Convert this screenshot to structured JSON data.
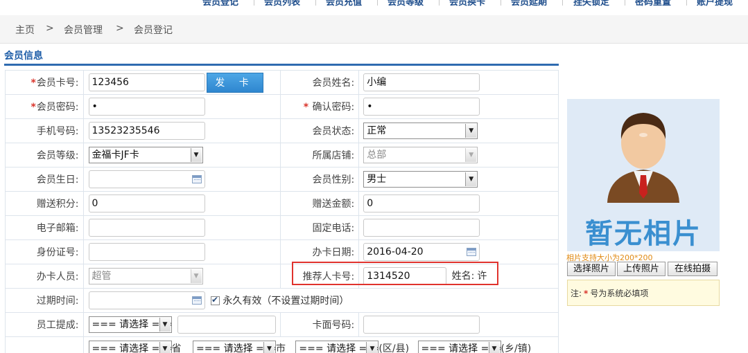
{
  "topnav": {
    "items": [
      "会员登记",
      "会员列表",
      "会员充值",
      "会员等级",
      "会员换卡",
      "会员延期",
      "挂失锁定",
      "密码重置",
      "账户提现"
    ]
  },
  "breadcrumb": [
    "主页",
    "会员管理",
    "会员登记"
  ],
  "breadcrumb_sep": ">",
  "section_title": "会员信息",
  "required_mark": "*",
  "form": {
    "card_no": {
      "label": "会员卡号:",
      "value": "123456"
    },
    "issue_button": "发 卡",
    "member_name": {
      "label": "会员姓名:",
      "value": "小编"
    },
    "password": {
      "label": "会员密码:",
      "value": "•"
    },
    "confirm_password": {
      "label": "确认密码:",
      "value": "•"
    },
    "phone": {
      "label": "手机号码:",
      "value": "13523235546"
    },
    "status": {
      "label": "会员状态:",
      "value": "正常"
    },
    "level": {
      "label": "会员等级:",
      "value": "金福卡JF卡"
    },
    "store": {
      "label": "所属店铺:",
      "value": "总部"
    },
    "birthday": {
      "label": "会员生日:",
      "value": ""
    },
    "gender": {
      "label": "会员性别:",
      "value": "男士"
    },
    "bonus_points": {
      "label": "赠送积分:",
      "value": "0"
    },
    "bonus_amount": {
      "label": "赠送金额:",
      "value": "0"
    },
    "email": {
      "label": "电子邮箱:",
      "value": ""
    },
    "landline": {
      "label": "固定电话:",
      "value": ""
    },
    "id_number": {
      "label": "身份证号:",
      "value": ""
    },
    "issue_date": {
      "label": "办卡日期:",
      "value": "2016-04-20"
    },
    "issuer": {
      "label": "办卡人员:",
      "value": "超管"
    },
    "referrer": {
      "label": "推荐人卡号:",
      "value": "1314520",
      "name_label": "姓名:",
      "name_value": "许"
    },
    "expiry": {
      "label": "过期时间:",
      "value": "",
      "permanent_label": "永久有效（不设置过期时间）",
      "permanent_checked": true
    },
    "commission": {
      "label": "员工提成:",
      "value": "=== 请选择 ==="
    },
    "card_face_no": {
      "label": "卡面号码:",
      "value": ""
    },
    "address": {
      "province": {
        "value": "=== 请选择 ===",
        "suffix": "省"
      },
      "city": {
        "value": "=== 请选择 ===",
        "suffix": "市"
      },
      "district": {
        "value": "=== 请选择 ===",
        "suffix": "(区/县)"
      },
      "town": {
        "value": "=== 请选择 ===",
        "suffix": "(乡/镇)"
      }
    }
  },
  "photo": {
    "placeholder_text": "暂无相片",
    "hint": "相片支持大小为200*200",
    "buttons": [
      "选择照片",
      "上传照片",
      "在线拍摄"
    ],
    "note_prefix": "注:",
    "note_text": "号为系统必填项"
  },
  "colors": {
    "accent": "#2f6bb0",
    "required": "#d9342b",
    "highlight": "#e0322d",
    "photo_bg": "#dfeaf6"
  }
}
